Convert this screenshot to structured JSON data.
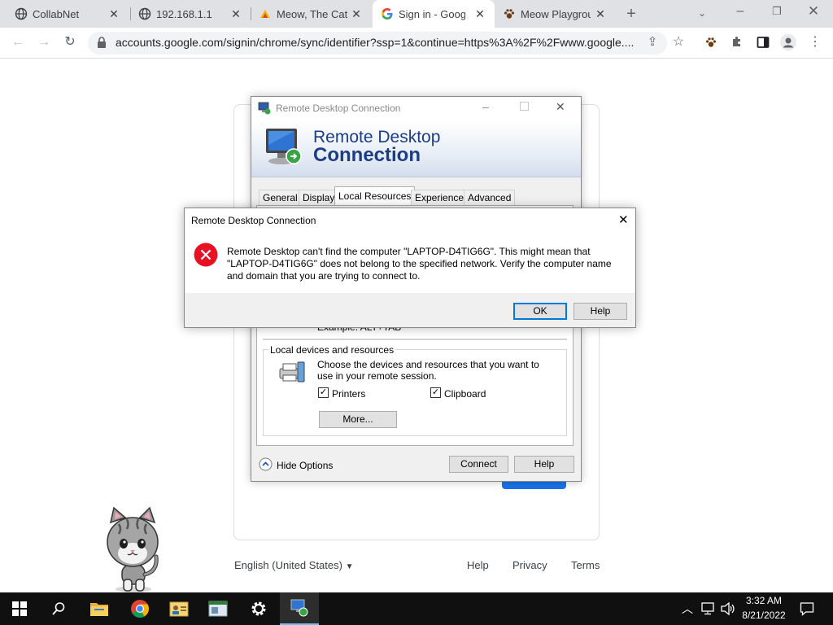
{
  "browser": {
    "tabs": [
      {
        "label": "CollabNet",
        "icon": "globe-icon"
      },
      {
        "label": "192.168.1.1",
        "icon": "globe-icon"
      },
      {
        "label": "Meow, The Cat",
        "icon": "wiki-icon"
      },
      {
        "label": "Sign in - Google",
        "icon": "google-icon"
      },
      {
        "label": "Meow Playground",
        "icon": "paw-icon"
      }
    ],
    "url": "accounts.google.com/signin/chrome/sync/identifier?ssp=1&continue=https%3A%2F%2Fwww.google...."
  },
  "google_page": {
    "language": "English (United States)",
    "footer_links": [
      "Help",
      "Privacy",
      "Terms"
    ]
  },
  "rdc": {
    "title": "Remote Desktop Connection",
    "banner_line1": "Remote Desktop",
    "banner_line2": "Connection",
    "tabs": [
      "General",
      "Display",
      "Local Resources",
      "Experience",
      "Advanced"
    ],
    "active_tab": "Local Resources",
    "hidden_example": "Example: ALT+TAB",
    "local_devices_group": "Local devices and resources",
    "local_devices_desc": "Choose the devices and resources that you want to use in your remote session.",
    "printers_label": "Printers",
    "printers_checked": true,
    "clipboard_label": "Clipboard",
    "clipboard_checked": true,
    "more_button": "More...",
    "hide_options": "Hide Options",
    "connect_button": "Connect",
    "help_button": "Help"
  },
  "error_dialog": {
    "title": "Remote Desktop Connection",
    "message": "Remote Desktop can't find the computer \"LAPTOP-D4TIG6G\". This might mean that \"LAPTOP-D4TIG6G\" does not belong to the specified network.  Verify the computer name and domain that you are trying to connect to.",
    "ok_button": "OK",
    "help_button": "Help"
  },
  "taskbar": {
    "time": "3:32 AM",
    "date": "8/21/2022"
  },
  "colors": {
    "google_blue": "#1a73e8",
    "rdc_banner_text": "#1c3d85",
    "error_red": "#e81123",
    "taskbar": "#101010"
  }
}
